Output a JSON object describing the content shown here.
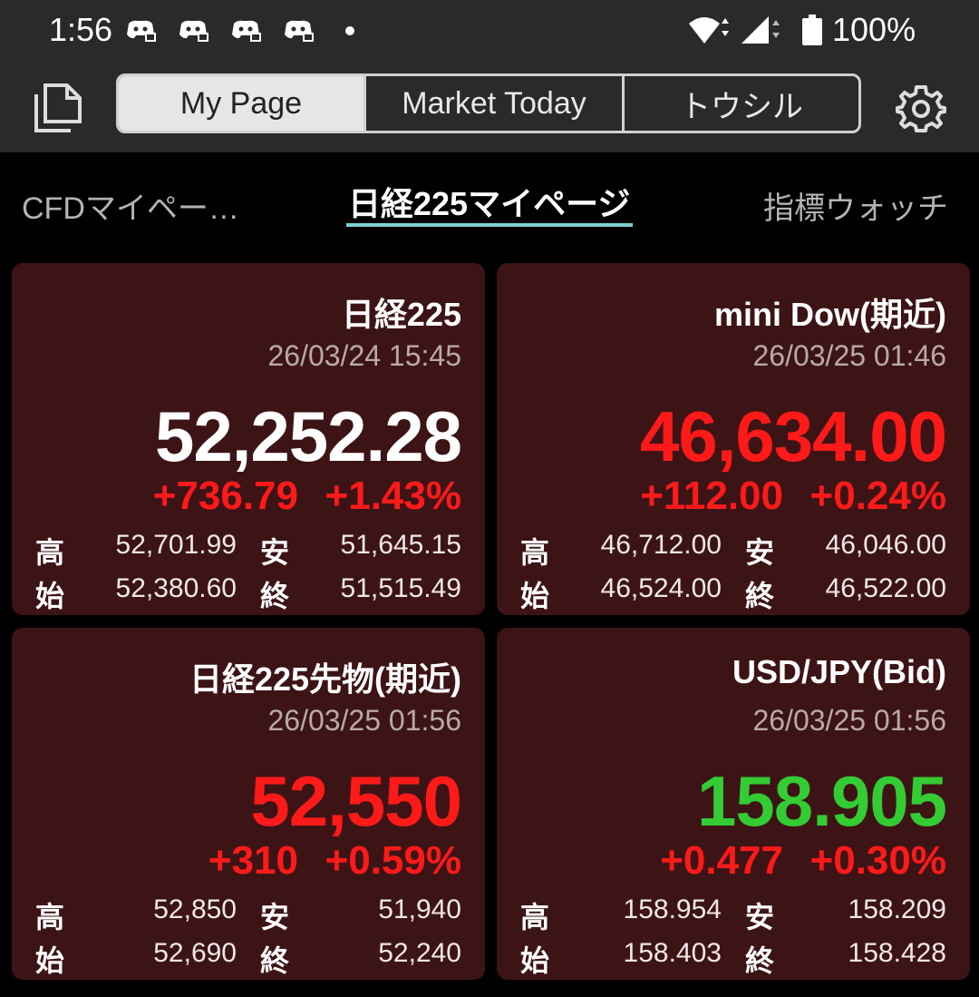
{
  "status_bar": {
    "time": "1:56",
    "battery": "100%"
  },
  "header": {
    "tabs": [
      "My Page",
      "Market Today",
      "トウシル"
    ]
  },
  "subtabs": {
    "left": "CFDマイペー…",
    "center": "日経225マイページ",
    "right": "指標ウォッチ"
  },
  "labels": {
    "high": "高",
    "low": "安",
    "open": "始",
    "close": "終"
  },
  "colors": {
    "up": "#ff1a1a",
    "down": "#33cc33",
    "neutral": "#ffffff",
    "card_bg": "#3d1416",
    "accent": "#7fd0cf"
  },
  "cards": [
    {
      "name": "日経225",
      "time": "26/03/24 15:45",
      "price": "52,252.28",
      "price_color": "neutral",
      "change": "+736.79",
      "pct": "+1.43%",
      "change_color": "up",
      "high": "52,701.99",
      "low": "51,645.15",
      "open": "52,380.60",
      "close": "51,515.49"
    },
    {
      "name": "mini Dow(期近)",
      "time": "26/03/25 01:46",
      "price": "46,634.00",
      "price_color": "up",
      "change": "+112.00",
      "pct": "+0.24%",
      "change_color": "up",
      "high": "46,712.00",
      "low": "46,046.00",
      "open": "46,524.00",
      "close": "46,522.00"
    },
    {
      "name": "日経225先物(期近)",
      "time": "26/03/25 01:56",
      "price": "52,550",
      "price_color": "up",
      "change": "+310",
      "pct": "+0.59%",
      "change_color": "up",
      "high": "52,850",
      "low": "51,940",
      "open": "52,690",
      "close": "52,240"
    },
    {
      "name": "USD/JPY(Bid)",
      "time": "26/03/25 01:56",
      "price": "158.905",
      "price_color": "down",
      "change": "+0.477",
      "pct": "+0.30%",
      "change_color": "up",
      "high": "158.954",
      "low": "158.209",
      "open": "158.403",
      "close": "158.428"
    }
  ]
}
